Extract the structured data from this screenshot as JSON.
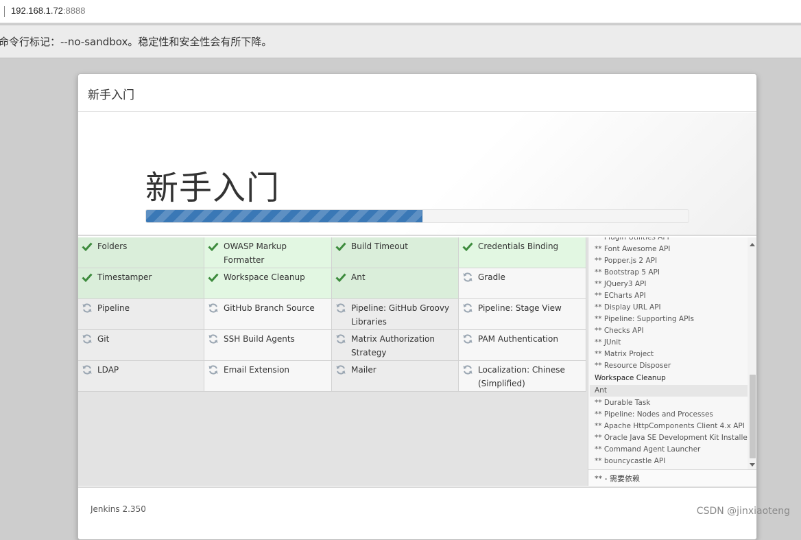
{
  "browser": {
    "url_host": "192.168.1.72",
    "url_port": ":8888",
    "warning_text": "命令行标记：--no-sandbox。稳定性和安全性会有所下降。"
  },
  "dialog": {
    "header_title": "新手入门",
    "hero_title": "新手入门",
    "progress_percent": 51,
    "footer_version": "Jenkins 2.350"
  },
  "plugins": [
    {
      "name": "Folders",
      "status": "installed"
    },
    {
      "name": "OWASP Markup Formatter",
      "status": "installed"
    },
    {
      "name": "Build Timeout",
      "status": "installed"
    },
    {
      "name": "Credentials Binding",
      "status": "installed"
    },
    {
      "name": "Timestamper",
      "status": "installed"
    },
    {
      "name": "Workspace Cleanup",
      "status": "installed"
    },
    {
      "name": "Ant",
      "status": "installed"
    },
    {
      "name": "Gradle",
      "status": "pending"
    },
    {
      "name": "Pipeline",
      "status": "pending"
    },
    {
      "name": "GitHub Branch Source",
      "status": "pending"
    },
    {
      "name": "Pipeline: GitHub Groovy Libraries",
      "status": "pending"
    },
    {
      "name": "Pipeline: Stage View",
      "status": "pending"
    },
    {
      "name": "Git",
      "status": "pending"
    },
    {
      "name": "SSH Build Agents",
      "status": "pending"
    },
    {
      "name": "Matrix Authorization Strategy",
      "status": "pending"
    },
    {
      "name": "PAM Authentication",
      "status": "pending"
    },
    {
      "name": "LDAP",
      "status": "pending"
    },
    {
      "name": "Email Extension",
      "status": "pending"
    },
    {
      "name": "Mailer",
      "status": "pending"
    },
    {
      "name": "Localization: Chinese (Simplified)",
      "status": "pending"
    }
  ],
  "log": {
    "lines": [
      {
        "text": "** Plugin Utilities API",
        "kind": "dep"
      },
      {
        "text": "** Font Awesome API",
        "kind": "dep"
      },
      {
        "text": "** Popper.js 2 API",
        "kind": "dep"
      },
      {
        "text": "** Bootstrap 5 API",
        "kind": "dep"
      },
      {
        "text": "** JQuery3 API",
        "kind": "dep"
      },
      {
        "text": "** ECharts API",
        "kind": "dep"
      },
      {
        "text": "** Display URL API",
        "kind": "dep"
      },
      {
        "text": "** Pipeline: Supporting APIs",
        "kind": "dep"
      },
      {
        "text": "** Checks API",
        "kind": "dep"
      },
      {
        "text": "** JUnit",
        "kind": "dep"
      },
      {
        "text": "** Matrix Project",
        "kind": "dep"
      },
      {
        "text": "** Resource Disposer",
        "kind": "dep"
      },
      {
        "text": "Workspace Cleanup",
        "kind": "head"
      },
      {
        "text": "Ant",
        "kind": "sel"
      },
      {
        "text": "** Durable Task",
        "kind": "dep"
      },
      {
        "text": "** Pipeline: Nodes and Processes",
        "kind": "dep"
      },
      {
        "text": "** Apache HttpComponents Client 4.x API",
        "kind": "dep"
      },
      {
        "text": "** Oracle Java SE Development Kit Installer",
        "kind": "dep"
      },
      {
        "text": "** Command Agent Launcher",
        "kind": "dep"
      },
      {
        "text": "** bouncycastle API",
        "kind": "dep"
      }
    ],
    "legend": "** - 需要依赖"
  },
  "watermark": "CSDN @jinxiaoteng",
  "colors": {
    "check": "#3d8b3d",
    "spinner": "#9aa6b2",
    "progress": "#3a78b6"
  }
}
